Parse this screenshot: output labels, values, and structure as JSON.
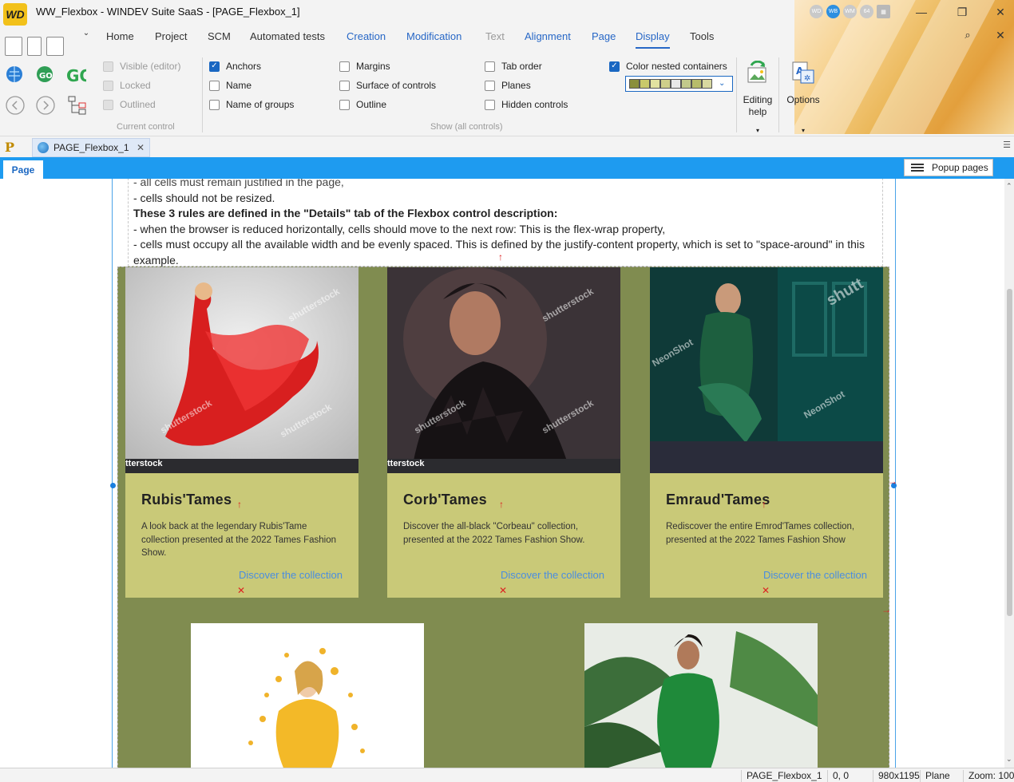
{
  "window": {
    "logo": "WD",
    "title": "WW_Flexbox - WINDEV Suite SaaS - [PAGE_Flexbox_1]",
    "badges": [
      "WD",
      "WB",
      "WM",
      "64"
    ]
  },
  "ribbon_tabs": [
    {
      "label": "Home",
      "style": "normal"
    },
    {
      "label": "Project",
      "style": "normal"
    },
    {
      "label": "SCM",
      "style": "normal"
    },
    {
      "label": "Automated tests",
      "style": "normal"
    },
    {
      "label": "Creation",
      "style": "blue"
    },
    {
      "label": "Modification",
      "style": "blue"
    },
    {
      "label": "Text",
      "style": "grey"
    },
    {
      "label": "Alignment",
      "style": "blue"
    },
    {
      "label": "Page",
      "style": "blue"
    },
    {
      "label": "Display",
      "style": "active"
    },
    {
      "label": "Tools",
      "style": "normal"
    }
  ],
  "current_control": {
    "label": "Current control",
    "items": [
      {
        "label": "Visible (editor)",
        "checked": false,
        "disabled": true
      },
      {
        "label": "Locked",
        "checked": false,
        "disabled": true
      },
      {
        "label": "Outlined",
        "checked": false,
        "disabled": true
      }
    ]
  },
  "show_all": {
    "label": "Show (all controls)",
    "col1": [
      {
        "label": "Anchors",
        "checked": true
      },
      {
        "label": "Name",
        "checked": false
      },
      {
        "label": "Name of groups",
        "checked": false
      }
    ],
    "col2": [
      {
        "label": "Margins",
        "checked": false
      },
      {
        "label": "Surface of controls",
        "checked": false
      },
      {
        "label": "Outline",
        "checked": false
      }
    ],
    "col3": [
      {
        "label": "Tab order",
        "checked": false
      },
      {
        "label": "Planes",
        "checked": false
      },
      {
        "label": "Hidden controls",
        "checked": false
      }
    ],
    "color_nested": {
      "label": "Color nested containers",
      "checked": true
    },
    "swatch_colors": [
      "#8a8f3c",
      "#c9c96a",
      "#e2e2a0",
      "#cfcf8a",
      "#e8e8e8",
      "#c2c98b",
      "#b7bc6a",
      "#d8d8a0",
      "#a4a85a"
    ]
  },
  "editing_help": {
    "line1": "Editing",
    "line2": "help"
  },
  "options_label": "Options",
  "doc_tab": {
    "label": "PAGE_Flexbox_1"
  },
  "page_bar": {
    "page_tab": "Page",
    "popup_pages": "Popup pages"
  },
  "text_block": {
    "line0": "- all cells must remain justified in the page,",
    "line1": "- cells should not be resized.",
    "line2": "These 3 rules are defined in the \"Details\" tab of the Flexbox control description:",
    "line3": "- when the browser is reduced horizontally, cells should move to the next row: This is the flex-wrap property,",
    "line4": "- cells must occupy all the available width and be evenly spaced. This is defined by the justify-content property, which is set to \"space-around\" in this",
    "line5": "example."
  },
  "cards": [
    {
      "title": "Rubis'Tames",
      "desc": "A look back at the legendary Rubis'Tame collection presented at the 2022 Tames Fashion Show.",
      "link": "Discover the collection"
    },
    {
      "title": "Corb'Tames",
      "desc": "Discover the all-black \"Corbeau\" collection, presented at the 2022 Tames Fashion Show.",
      "link": "Discover the collection"
    },
    {
      "title": "Emraud'Tames",
      "desc": "Rediscover the entire Emrod'Tames collection, presented at the 2022 Tames Fashion Show",
      "link": "Discover the collection"
    }
  ],
  "watermarks": {
    "shutterstock": "shutterstock",
    "tterstock": "tterstock",
    "neonshot": "NeonShot",
    "shutt": "shutt"
  },
  "status": {
    "page": "PAGE_Flexbox_1",
    "coords": "0, 0",
    "size": "980x1195",
    "plane": "Plane",
    "zoom": "Zoom: 100"
  },
  "colors": {
    "accent": "#1e9bf0",
    "flexbox_bg": "#808c50",
    "card_bg": "#c9c978",
    "link": "#4a8de0"
  }
}
